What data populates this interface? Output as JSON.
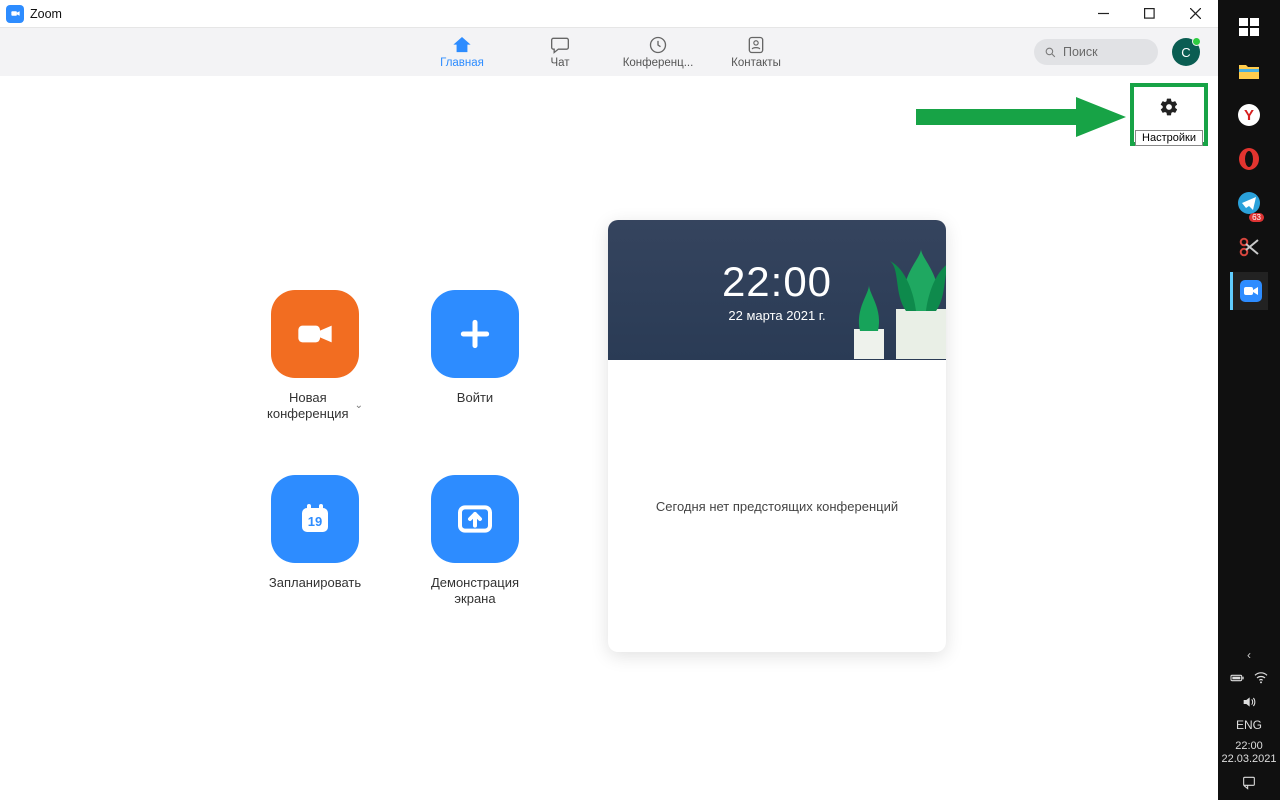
{
  "window": {
    "title": "Zoom"
  },
  "tabs": {
    "home": "Главная",
    "chat": "Чат",
    "conf": "Конференц...",
    "contacts": "Контакты"
  },
  "search": {
    "placeholder": "Поиск"
  },
  "avatar": {
    "initial": "C"
  },
  "settings": {
    "tooltip": "Настройки"
  },
  "actions": {
    "newmeeting": "Новая\nконференция",
    "join": "Войти",
    "schedule": "Запланировать",
    "schedule_day": "19",
    "share": "Демонстрация\nэкрана"
  },
  "panel": {
    "time": "22:00",
    "date": "22 марта 2021 г.",
    "empty": "Сегодня нет предстоящих конференций"
  },
  "tray": {
    "lang": "ENG",
    "time": "22:00",
    "date": "22.03.2021",
    "telegram_badge": "63"
  }
}
